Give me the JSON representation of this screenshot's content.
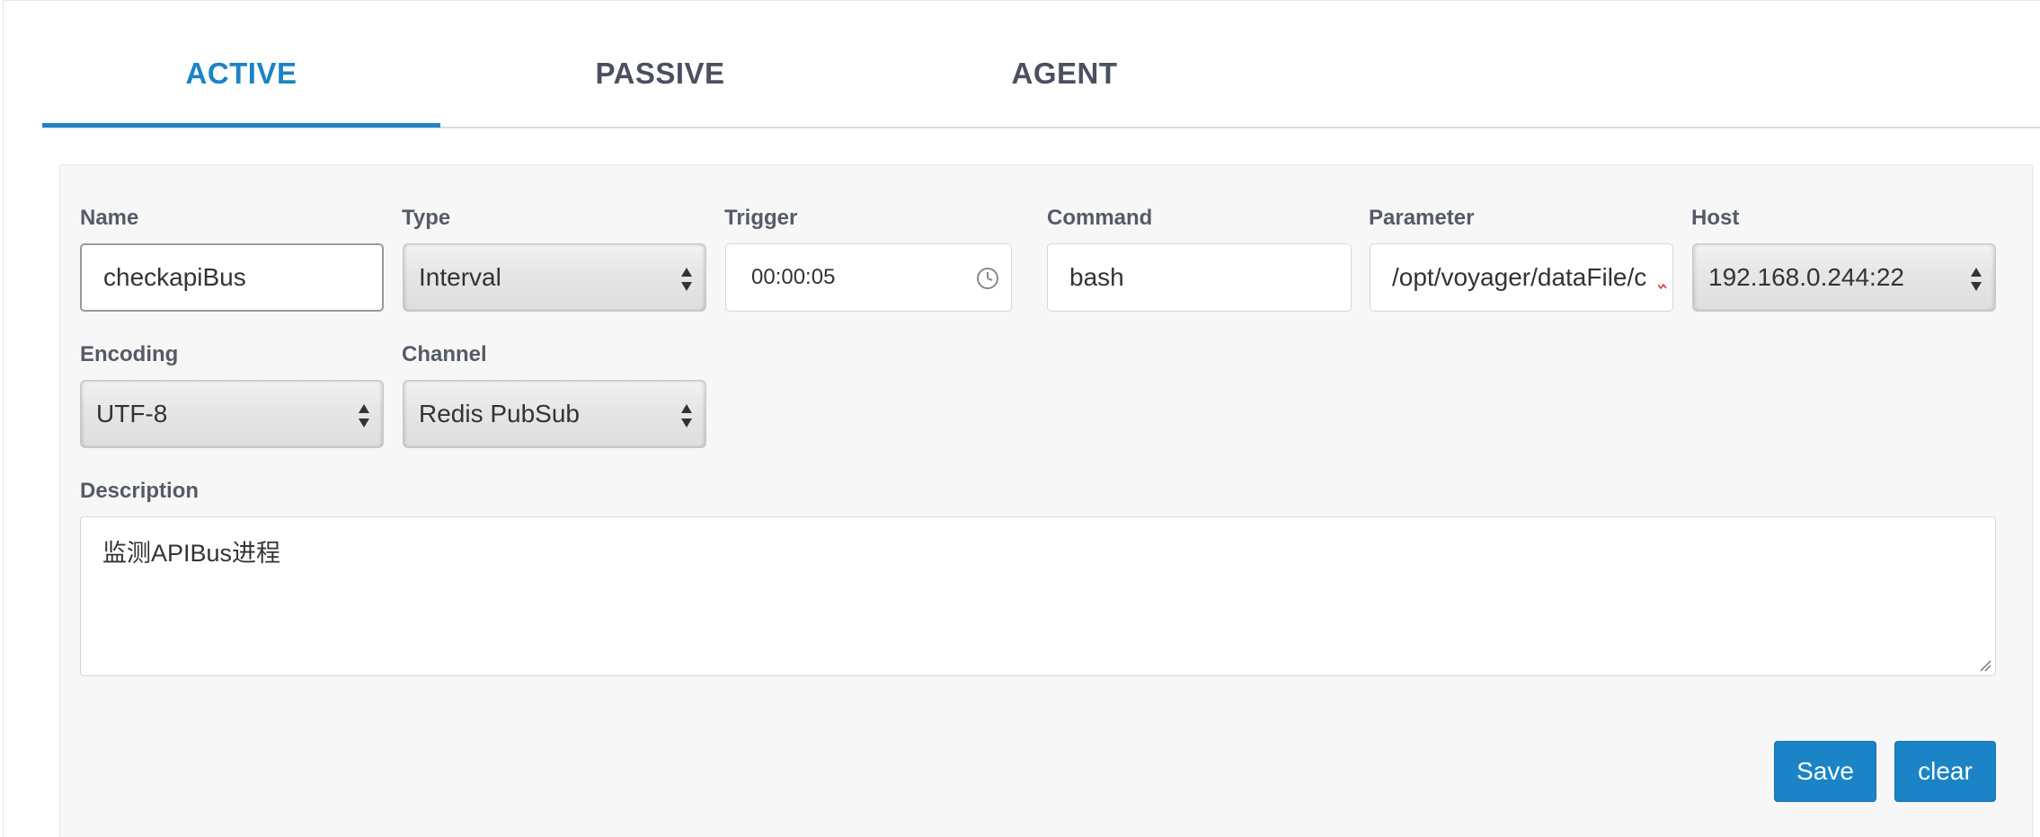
{
  "tabs": [
    {
      "label": "ACTIVE"
    },
    {
      "label": "PASSIVE"
    },
    {
      "label": "AGENT"
    }
  ],
  "form": {
    "name": {
      "label": "Name",
      "value": "checkapiBus"
    },
    "type": {
      "label": "Type",
      "selected": "Interval"
    },
    "trigger": {
      "label": "Trigger",
      "value": "00:00:05",
      "icon": "clock-icon"
    },
    "command": {
      "label": "Command",
      "value": "bash"
    },
    "parameter": {
      "label": "Parameter",
      "value": "/opt/voyager/dataFile/c"
    },
    "host": {
      "label": "Host",
      "selected": "192.168.0.244:22"
    },
    "encoding": {
      "label": "Encoding",
      "selected": "UTF-8"
    },
    "channel": {
      "label": "Channel",
      "selected": "Redis PubSub"
    },
    "description": {
      "label": "Description",
      "value": "监测APIBus进程"
    }
  },
  "buttons": {
    "save_label": "Save",
    "clear_label": "clear"
  },
  "colors": {
    "accent": "#1b84c6",
    "tab_inactive": "#4a5060",
    "panel_bg": "#f7f7f7"
  }
}
